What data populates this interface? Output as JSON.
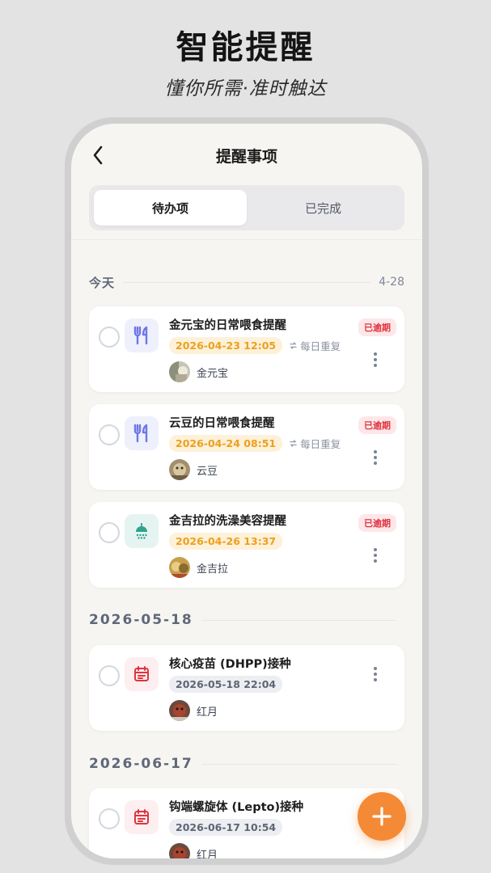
{
  "promo": {
    "title": "智能提醒",
    "subtitle": "懂你所需·准时触达"
  },
  "nav": {
    "title": "提醒事项"
  },
  "tabs": [
    {
      "label": "待办项",
      "active": true
    },
    {
      "label": "已完成",
      "active": false
    }
  ],
  "groups": [
    {
      "label": "今天",
      "right": "4-28",
      "items": [
        {
          "title": "金元宝的日常喂食提醒",
          "time": "2026-04-23 12:05",
          "repeat": "每日重复",
          "pet": "金元宝",
          "overdue": "已逾期",
          "icon": "utensils-icon"
        },
        {
          "title": "云豆的日常喂食提醒",
          "time": "2026-04-24 08:51",
          "repeat": "每日重复",
          "pet": "云豆",
          "overdue": "已逾期",
          "icon": "utensils-icon"
        },
        {
          "title": "金吉拉的洗澡美容提醒",
          "time": "2026-04-26 13:37",
          "pet": "金吉拉",
          "overdue": "已逾期",
          "icon": "shower-icon"
        }
      ]
    },
    {
      "label": "2026-05-18",
      "items": [
        {
          "title": "核心疫苗 (DHPP)接种",
          "time": "2026-05-18 22:04",
          "pet": "红月",
          "icon": "calendar-icon"
        }
      ]
    },
    {
      "label": "2026-06-17",
      "items": [
        {
          "title": "钩端螺旋体 (Lepto)接种",
          "time": "2026-06-17 10:54",
          "pet": "红月",
          "icon": "calendar-icon"
        }
      ]
    }
  ],
  "colors": {
    "accent": "#f48a36",
    "overdue": "#e0343f",
    "time_orange": "#eca01f",
    "purple_icon": "#6f76e6",
    "teal_icon": "#2fa38e",
    "red_icon": "#e0343f"
  }
}
